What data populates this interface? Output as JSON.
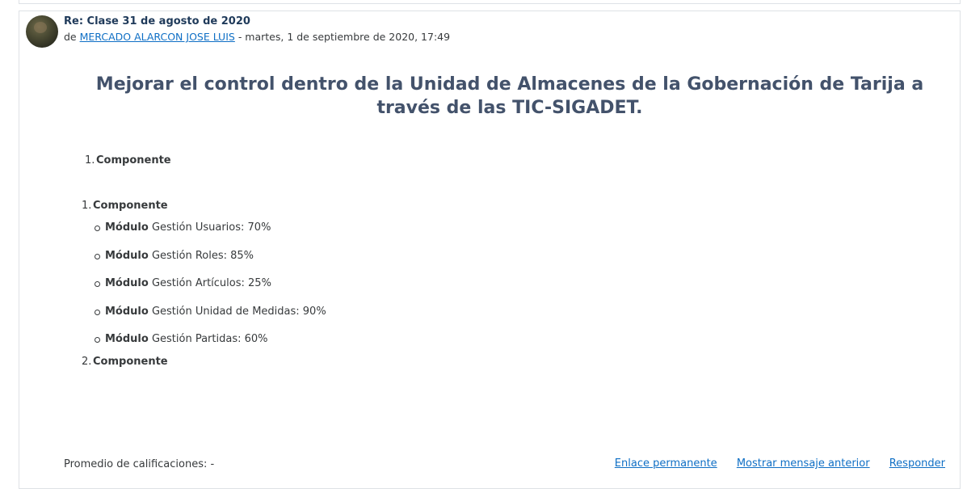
{
  "post": {
    "subject": "Re: Clase 31 de agosto de 2020",
    "by_prefix": "de",
    "author": "MERCADO ALARCON JOSE LUIS",
    "date": "- martes, 1 de septiembre de 2020, 17:49"
  },
  "content": {
    "headline": "Mejorar el control dentro de la Unidad de Almacenes de la Gobernación de Tarija a través de las TIC-SIGADET.",
    "list_a": [
      {
        "num": "1.",
        "label": "Componente"
      }
    ],
    "list_b": {
      "item1": {
        "num": "1.",
        "label": "Componente"
      },
      "modules": [
        {
          "bold": "Módulo",
          "text": " Gestión Usuarios: 70%"
        },
        {
          "bold": "Módulo",
          "text": " Gestión Roles: 85%"
        },
        {
          "bold": "Módulo",
          "text": " Gestión Artículos: 25%"
        },
        {
          "bold": "Módulo",
          "text": " Gestión Unidad de Medidas: 90%"
        },
        {
          "bold": "Módulo",
          "text": " Gestión Partidas: 60%"
        }
      ],
      "item2": {
        "num": "2.",
        "label": "Componente"
      }
    }
  },
  "footer": {
    "rating": "Promedio de calificaciones: -",
    "permalink": "Enlace permanente",
    "show_parent": "Mostrar mensaje anterior",
    "reply": "Responder"
  }
}
